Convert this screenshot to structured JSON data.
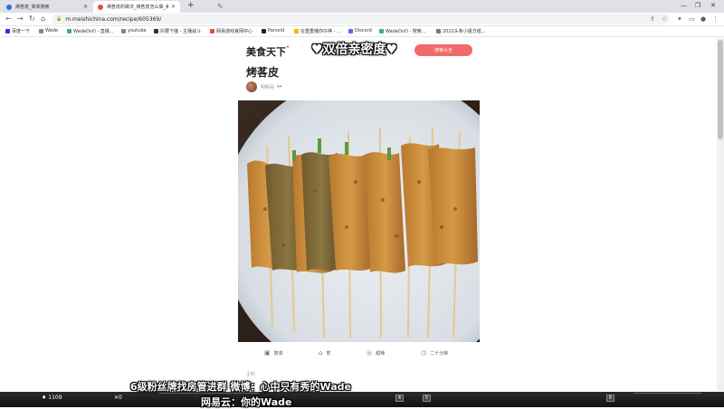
{
  "browser": {
    "tabs": [
      {
        "title": "烤茖皮_简单搜索",
        "favicon_color": "#2b6fd6"
      },
      {
        "title": "烤茖皮的做法_烤茖皮怎么做_美",
        "favicon_color": "#e74c3c"
      }
    ],
    "new_tab": "+",
    "url": "m.meishichina.com/recipe/605369/",
    "bookmarks": [
      {
        "label": "百度一下",
        "color": "#2932e1"
      },
      {
        "label": "Wade",
        "color": "#888888"
      },
      {
        "label": "WadeOvO - 直播...",
        "color": "#3cb371"
      },
      {
        "label": "youtube",
        "color": "#888888"
      },
      {
        "label": "抖要下播 - 主播战斗",
        "color": "#333333"
      },
      {
        "label": "网易游戏官网中心",
        "color": "#e74c3c"
      },
      {
        "label": "Parsoid",
        "color": "#222222"
      },
      {
        "label": "在重重播你仔神 - ...",
        "color": "#f5b400"
      },
      {
        "label": "Discord",
        "color": "#5865f2"
      },
      {
        "label": "WadeOvO - 搜索...",
        "color": "#3cb371"
      },
      {
        "label": "2022头条小姐方纸...",
        "color": "#777777"
      }
    ]
  },
  "page": {
    "site_name": "美食天下",
    "site_dot": "•",
    "search_button": "搜索大全",
    "overlay_text": "♥双倍亲密度♥",
    "recipe_title": "烤茖皮",
    "author_name": "明明哥",
    "author_badge": "👀",
    "meta": [
      {
        "icon": "▣",
        "label": "简单"
      },
      {
        "icon": "⌂",
        "label": "煎"
      },
      {
        "icon": "◎",
        "label": "甜辣"
      },
      {
        "icon": "◷",
        "label": "二十分钟"
      }
    ],
    "section_label": "主料"
  },
  "stream": {
    "subtitle_1": "6级粉丝牌找房管进群  微博：心中只有秀的Wade",
    "subtitle_2": "网易云：你的Wade",
    "viewer_count": "1109",
    "zero_count": "0",
    "keys": [
      "4",
      "5",
      "6"
    ]
  }
}
